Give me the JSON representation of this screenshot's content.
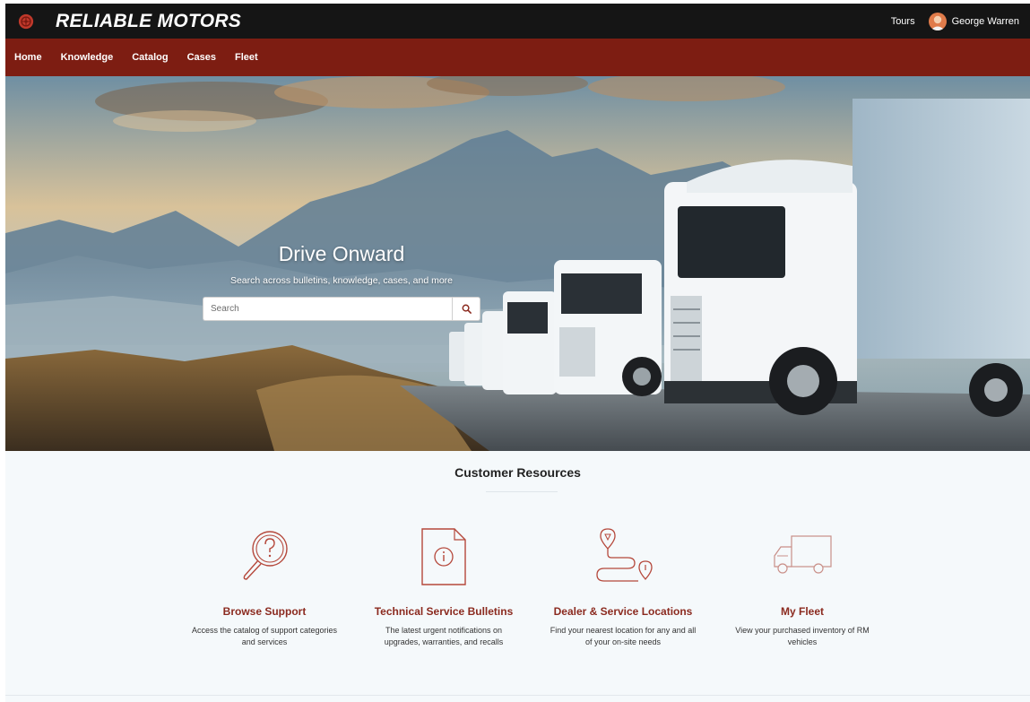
{
  "header": {
    "brand": "RELIABLE MOTORS",
    "tours_label": "Tours",
    "user_name": "George Warren"
  },
  "nav": {
    "items": [
      "Home",
      "Knowledge",
      "Catalog",
      "Cases",
      "Fleet"
    ]
  },
  "hero": {
    "title": "Drive Onward",
    "subtitle": "Search across bulletins, knowledge, cases, and more",
    "search_placeholder": "Search"
  },
  "resources": {
    "title": "Customer Resources",
    "cards": [
      {
        "title": "Browse Support",
        "description": "Access the catalog of support categories and services",
        "icon": "magnifier-question-icon"
      },
      {
        "title": "Technical Service Bulletins",
        "description": "The latest urgent notifications on upgrades, warranties, and recalls",
        "icon": "document-info-icon"
      },
      {
        "title": "Dealer & Service Locations",
        "description": "Find your nearest location for any and all of your on-site needs",
        "icon": "route-pins-icon"
      },
      {
        "title": "My Fleet",
        "description": "View your purchased inventory of RM vehicles",
        "icon": "truck-icon"
      }
    ]
  },
  "colors": {
    "topbar": "#151515",
    "navbar": "#7d1d12",
    "accent": "#8b2a1f",
    "page_bg": "#f5f9fb"
  }
}
